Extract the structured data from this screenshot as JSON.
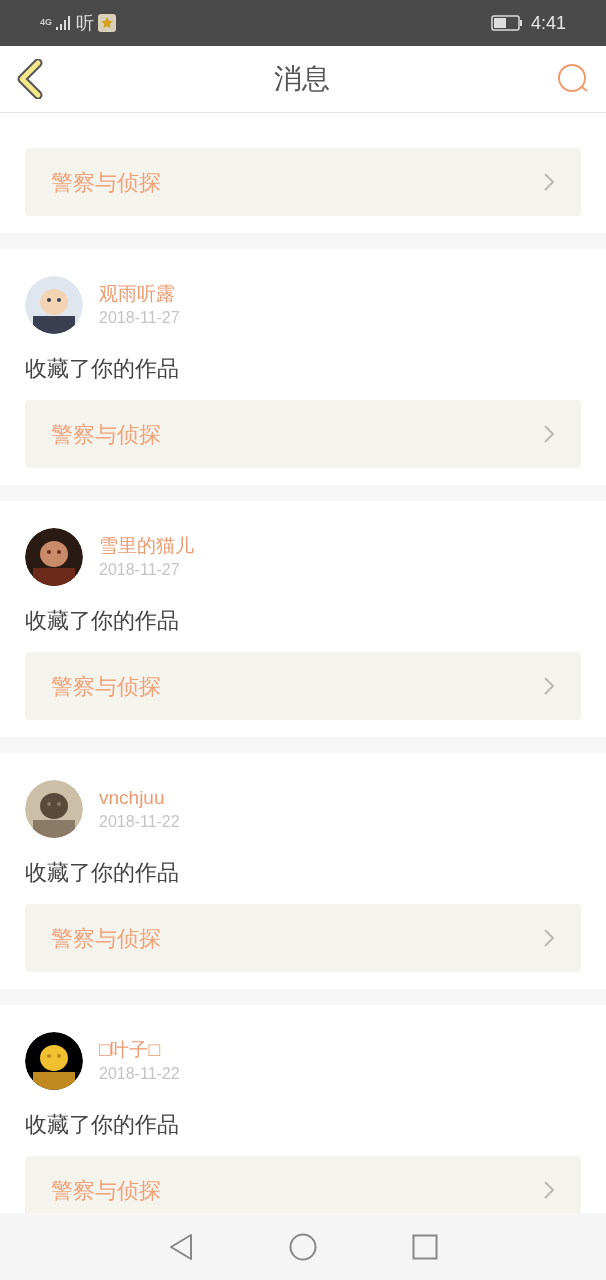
{
  "status_bar": {
    "network": "4G",
    "app_label": "听",
    "time": "4:41"
  },
  "header": {
    "title": "消息"
  },
  "partial_item": {
    "work": "警察与侦探"
  },
  "messages": [
    {
      "name": "观雨听露",
      "date": "2018-11-27",
      "text": "收藏了你的作品",
      "work": "警察与侦探"
    },
    {
      "name": "雪里的猫儿",
      "date": "2018-11-27",
      "text": "收藏了你的作品",
      "work": "警察与侦探"
    },
    {
      "name": "vnchjuu",
      "date": "2018-11-22",
      "text": "收藏了你的作品",
      "work": "警察与侦探"
    },
    {
      "name": "□叶子□",
      "date": "2018-11-22",
      "text": "收藏了你的作品",
      "work": "警察与侦探"
    }
  ]
}
